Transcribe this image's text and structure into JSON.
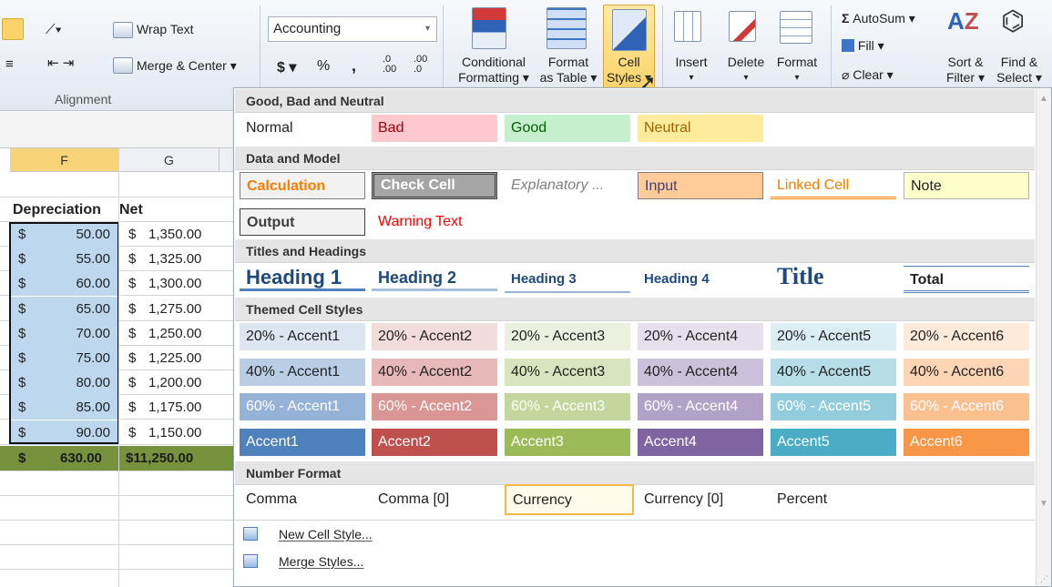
{
  "ribbon": {
    "wrap_text": "Wrap Text",
    "merge_center": "Merge & Center",
    "alignment_group": "Alignment",
    "number_format": "Accounting",
    "currency_symbol": "$",
    "percent_symbol": "%",
    "comma_symbol": ",",
    "dec_increase": ".0 .00",
    "dec_decrease": ".00 .0",
    "conditional_1": "Conditional",
    "conditional_2": "Formatting ▾",
    "format_table_1": "Format",
    "format_table_2": "as Table ▾",
    "cell_styles_1": "Cell",
    "cell_styles_2": "Styles ▾",
    "insert": "Insert",
    "delete": "Delete",
    "format": "Format",
    "autosum": "AutoSum ▾",
    "fill": "Fill ▾",
    "clear": "Clear ▾",
    "sort_1": "Sort &",
    "sort_2": "Filter ▾",
    "find_1": "Find &",
    "find_2": "Select ▾",
    "colors": {
      "accent_highlight": "#fbd469",
      "ribbon_bg": "#e2e8f1"
    }
  },
  "sheet": {
    "col_f": "F",
    "col_g": "G",
    "header_depreciation": "Depreciation",
    "header_net": "Net",
    "rows": [
      {
        "dep": "50.00",
        "net": "1,350.00"
      },
      {
        "dep": "55.00",
        "net": "1,325.00"
      },
      {
        "dep": "60.00",
        "net": "1,300.00"
      },
      {
        "dep": "65.00",
        "net": "1,275.00"
      },
      {
        "dep": "70.00",
        "net": "1,250.00"
      },
      {
        "dep": "75.00",
        "net": "1,225.00"
      },
      {
        "dep": "80.00",
        "net": "1,200.00"
      },
      {
        "dep": "85.00",
        "net": "1,175.00"
      },
      {
        "dep": "90.00",
        "net": "1,150.00"
      }
    ],
    "currency": "$",
    "total_dep": "630.00",
    "total_net": "$11,250.00",
    "colors": {
      "selection": "#bdd7ee",
      "total_bg": "#76923c"
    }
  },
  "gallery": {
    "sections": {
      "good_bad": "Good, Bad and Neutral",
      "data_model": "Data and Model",
      "titles": "Titles and Headings",
      "themed": "Themed Cell Styles",
      "number": "Number Format"
    },
    "good_bad": [
      "Normal",
      "Bad",
      "Good",
      "Neutral"
    ],
    "data_model": [
      "Calculation",
      "Check Cell",
      "Explanatory ...",
      "Input",
      "Linked Cell",
      "Note",
      "Output",
      "Warning Text"
    ],
    "titles": [
      "Heading 1",
      "Heading 2",
      "Heading 3",
      "Heading 4",
      "Title",
      "Total"
    ],
    "accent20": [
      "20% - Accent1",
      "20% - Accent2",
      "20% - Accent3",
      "20% - Accent4",
      "20% - Accent5",
      "20% - Accent6"
    ],
    "accent40": [
      "40% - Accent1",
      "40% - Accent2",
      "40% - Accent3",
      "40% - Accent4",
      "40% - Accent5",
      "40% - Accent6"
    ],
    "accent60": [
      "60% - Accent1",
      "60% - Accent2",
      "60% - Accent3",
      "60% - Accent4",
      "60% - Accent5",
      "60% - Accent6"
    ],
    "accent100": [
      "Accent1",
      "Accent2",
      "Accent3",
      "Accent4",
      "Accent5",
      "Accent6"
    ],
    "number": [
      "Comma",
      "Comma [0]",
      "Currency",
      "Currency [0]",
      "Percent"
    ],
    "new_style": "New Cell Style...",
    "merge_styles": "Merge Styles...",
    "colors": {
      "bad": "#ffc7ce",
      "good": "#c6efce",
      "neutral": "#ffeb9c",
      "accent1": "#4f81bd",
      "accent2": "#c0504d",
      "accent3": "#9bbb59",
      "accent4": "#8064a2",
      "accent5": "#4bacc6",
      "accent6": "#f79646"
    }
  }
}
